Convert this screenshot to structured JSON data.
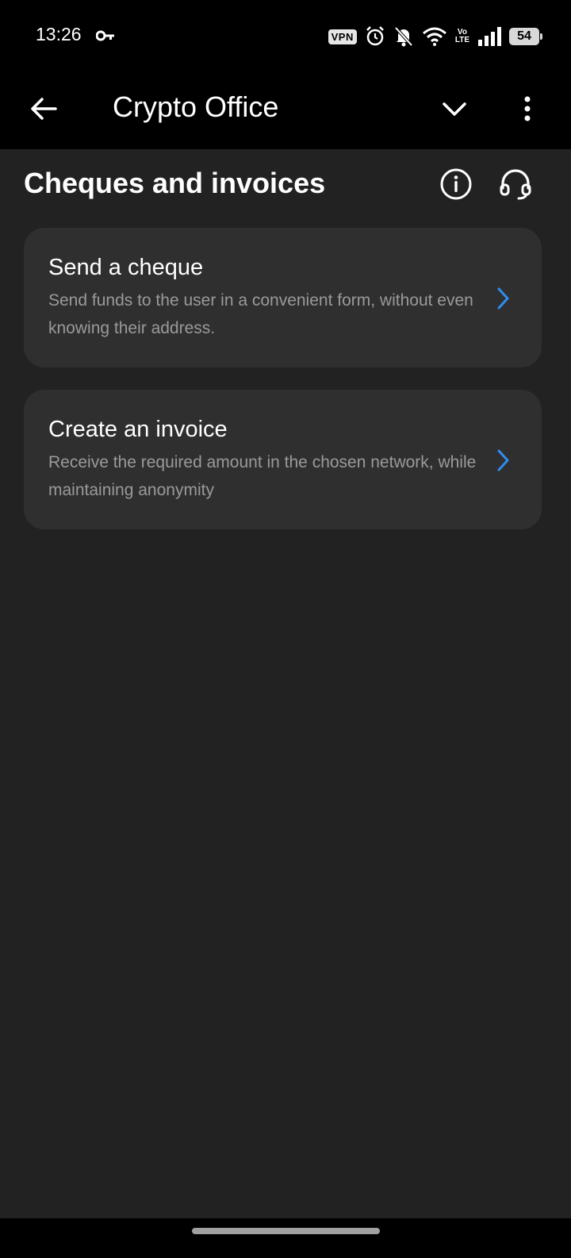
{
  "status_bar": {
    "time": "13:26",
    "vpn_label": "VPN",
    "volte_top": "Vo",
    "volte_bottom": "LTE",
    "battery": "54"
  },
  "app_bar": {
    "title": "Crypto Office"
  },
  "section": {
    "title": "Cheques and invoices"
  },
  "cards": [
    {
      "title": "Send a cheque",
      "description": "Send funds to the user in a convenient form, without even knowing their address."
    },
    {
      "title": "Create an invoice",
      "description": "Receive the required amount in the chosen network, while maintaining anonymity"
    }
  ],
  "colors": {
    "background": "#222222",
    "card": "#2f2f2f",
    "accent": "#2f8cf0",
    "secondary_text": "#9a9a9a"
  },
  "icons": {
    "back": "arrow-left-icon",
    "dropdown": "chevron-down-icon",
    "more": "more-vertical-icon",
    "info": "info-icon",
    "support": "headset-icon",
    "card_action": "chevron-right-icon"
  }
}
